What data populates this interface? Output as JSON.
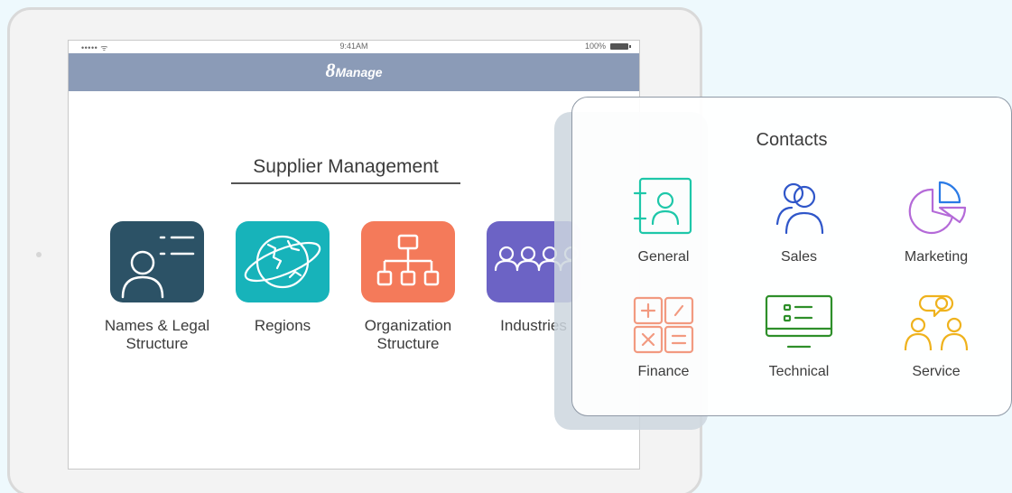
{
  "status_bar": {
    "signal": "••••• ᯤ",
    "time": "9:41AM",
    "battery": "100%"
  },
  "app": {
    "brand_number": "8",
    "brand_name": "Manage"
  },
  "main": {
    "title": "Supplier Management",
    "tiles": [
      {
        "label": "Names & Legal\nStructure",
        "icon": "contact-card-icon",
        "color": "#2c5266"
      },
      {
        "label": "Regions",
        "icon": "globe-icon",
        "color": "#17b3ba"
      },
      {
        "label": "Organization\nStructure",
        "icon": "org-chart-icon",
        "color": "#f47a5a"
      },
      {
        "label": "Industries",
        "icon": "people-group-icon",
        "color": "#6c63c5"
      }
    ]
  },
  "popup": {
    "title": "Contacts",
    "items": [
      {
        "label": "General",
        "icon": "address-book-icon",
        "color": "#1ec7a9"
      },
      {
        "label": "Sales",
        "icon": "users-icon",
        "color": "#2f56c9"
      },
      {
        "label": "Marketing",
        "icon": "pie-chart-icon",
        "color": "#b46ad8"
      },
      {
        "label": "Finance",
        "icon": "calculator-icon",
        "color": "#f29a80"
      },
      {
        "label": "Technical",
        "icon": "monitor-list-icon",
        "color": "#2e8f2a"
      },
      {
        "label": "Service",
        "icon": "customer-service-icon",
        "color": "#efb21d"
      }
    ]
  }
}
